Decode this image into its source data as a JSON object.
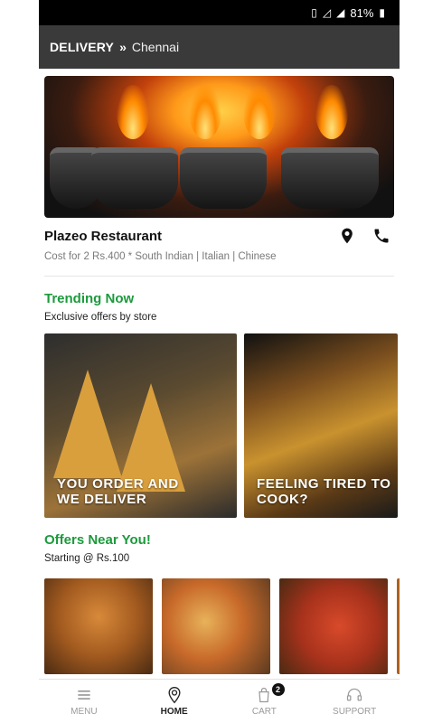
{
  "status": {
    "battery": "81%"
  },
  "topbar": {
    "mode": "DELIVERY",
    "chevron": "»",
    "city": "Chennai"
  },
  "restaurant": {
    "name": "Plazeo Restaurant",
    "meta": "Cost for 2 Rs.400 * South Indian | Italian | Chinese"
  },
  "trending": {
    "title": "Trending Now",
    "subtitle": "Exclusive offers by store",
    "cards": [
      {
        "caption_line1": "YOU ORDER AND",
        "caption_line2": "WE DELIVER"
      },
      {
        "caption_line1": "FEELING TIRED TO",
        "caption_line2": "COOK?"
      }
    ]
  },
  "offers": {
    "title": "Offers Near You!",
    "subtitle": "Starting @ Rs.100"
  },
  "nav": {
    "items": [
      {
        "label": "MENU",
        "icon": "menu-icon"
      },
      {
        "label": "HOME",
        "icon": "location-pin-icon"
      },
      {
        "label": "CART",
        "icon": "shopping-bag-icon",
        "badge": "2"
      },
      {
        "label": "SUPPORT",
        "icon": "headset-icon"
      }
    ]
  },
  "colors": {
    "accent": "#1c9a3c",
    "topbar": "#3a3a3a"
  }
}
